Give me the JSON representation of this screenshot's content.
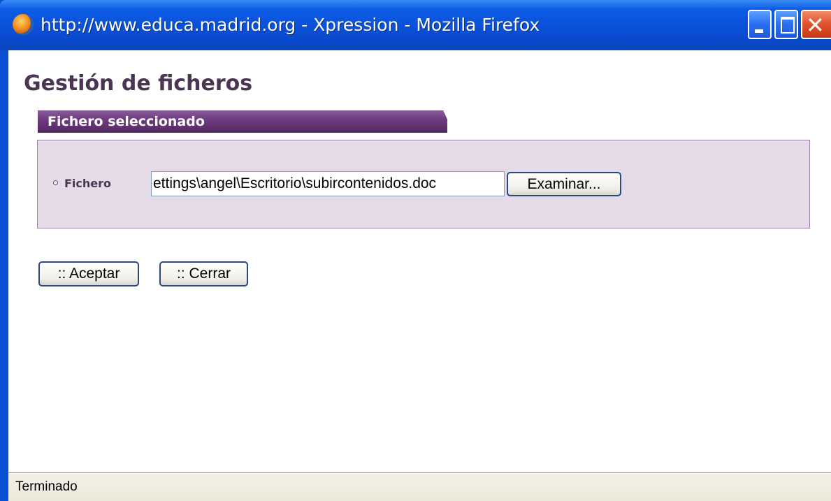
{
  "window": {
    "title": "http://www.educa.madrid.org - Xpression - Mozilla Firefox",
    "close_glyph": "✕"
  },
  "page": {
    "heading": "Gestión de ficheros",
    "section_title": "Fichero seleccionado",
    "field_label": "Fichero",
    "file_value": "ettings\\angel\\Escritorio\\subircontenidos.doc",
    "browse_label": "Examinar...",
    "accept_label": ":: Aceptar",
    "close_label": ":: Cerrar"
  },
  "status": {
    "text": "Terminado"
  },
  "colors": {
    "accent_purple": "#6e3c82",
    "panel_bg": "#e5dbe9",
    "heading_color": "#4a3552",
    "titlebar_blue": "#0a50d8"
  }
}
